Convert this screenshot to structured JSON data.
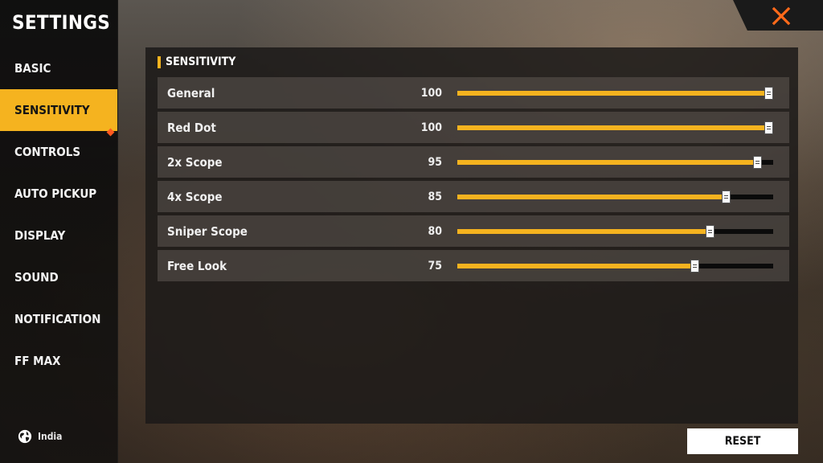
{
  "sidebar": {
    "title": "SETTINGS",
    "items": [
      {
        "label": "BASIC",
        "active": false
      },
      {
        "label": "SENSITIVITY",
        "active": true
      },
      {
        "label": "CONTROLS",
        "active": false
      },
      {
        "label": "AUTO PICKUP",
        "active": false
      },
      {
        "label": "DISPLAY",
        "active": false
      },
      {
        "label": "SOUND",
        "active": false
      },
      {
        "label": "NOTIFICATION",
        "active": false
      },
      {
        "label": "FF MAX",
        "active": false
      }
    ],
    "region": {
      "icon": "globe-icon",
      "label": "India"
    }
  },
  "close": {
    "icon": "close-icon",
    "color": "#ff6a1a"
  },
  "panel": {
    "section_title": "SENSITIVITY",
    "sliders": [
      {
        "label": "General",
        "value": "100",
        "level": 1.0
      },
      {
        "label": "Red Dot",
        "value": "100",
        "level": 1.0
      },
      {
        "label": "2x Scope",
        "value": "95",
        "level": 0.95
      },
      {
        "label": "4x Scope",
        "value": "85",
        "level": 0.85
      },
      {
        "label": "Sniper Scope",
        "value": "80",
        "level": 0.8
      },
      {
        "label": "Free Look",
        "value": "75",
        "level": 0.75
      }
    ]
  },
  "reset": {
    "label": "RESET"
  },
  "colors": {
    "accent": "#f5b31f",
    "notification_dot": "#ff5a1f",
    "track": "#0b0b0b"
  }
}
